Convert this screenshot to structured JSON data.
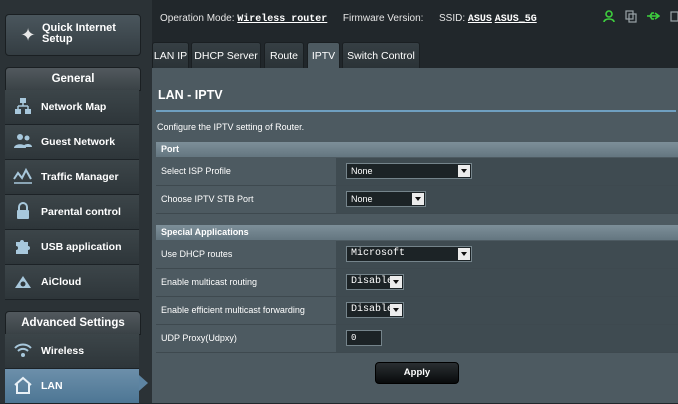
{
  "sidebar": {
    "quick_setup": {
      "label": "Quick Internet Setup",
      "icon": "wand-icon"
    },
    "general_heading": "General",
    "general_items": [
      {
        "label": "Network Map",
        "icon": "network-map-icon"
      },
      {
        "label": "Guest Network",
        "icon": "guest-network-icon"
      },
      {
        "label": "Traffic Manager",
        "icon": "traffic-manager-icon"
      },
      {
        "label": "Parental control",
        "icon": "lock-icon"
      },
      {
        "label": "USB application",
        "icon": "puzzle-icon"
      },
      {
        "label": "AiCloud",
        "icon": "cloud-icon"
      }
    ],
    "advanced_heading": "Advanced Settings",
    "advanced_items": [
      {
        "label": "Wireless",
        "icon": "wifi-icon"
      },
      {
        "label": "LAN",
        "icon": "home-icon",
        "active": true
      }
    ]
  },
  "header": {
    "operation_mode_label": "Operation Mode:",
    "operation_mode_value": "Wireless router",
    "firmware_label": "Firmware Version:",
    "ssid_label": "SSID:",
    "ssid_values": [
      "ASUS",
      "ASUS_5G"
    ],
    "status_icons": [
      "user-icon",
      "copy-icon",
      "usb-icon",
      "printer-icon"
    ],
    "colors": {
      "accent": "#6f9fc0",
      "status_green": "#3ecf3e"
    }
  },
  "tabs": [
    {
      "label": "LAN IP"
    },
    {
      "label": "DHCP Server"
    },
    {
      "label": "Route"
    },
    {
      "label": "IPTV",
      "active": true
    },
    {
      "label": "Switch Control"
    }
  ],
  "page": {
    "title": "LAN - IPTV",
    "description": "Configure the IPTV setting of Router.",
    "port_group": {
      "title": "Port",
      "select_isp_profile": {
        "label": "Select ISP Profile",
        "value": "None"
      },
      "choose_stb_port": {
        "label": "Choose IPTV STB Port",
        "value": "None"
      }
    },
    "special_group": {
      "title": "Special Applications",
      "use_dhcp_routes": {
        "label": "Use DHCP routes",
        "value": "Microsoft"
      },
      "multicast_routing": {
        "label": "Enable multicast routing",
        "value": "Disable"
      },
      "efficient_multicast": {
        "label": "Enable efficient multicast forwarding",
        "value": "Disable"
      },
      "udp_proxy": {
        "label": "UDP Proxy(Udpxy)",
        "value": "0"
      }
    },
    "apply_label": "Apply"
  }
}
